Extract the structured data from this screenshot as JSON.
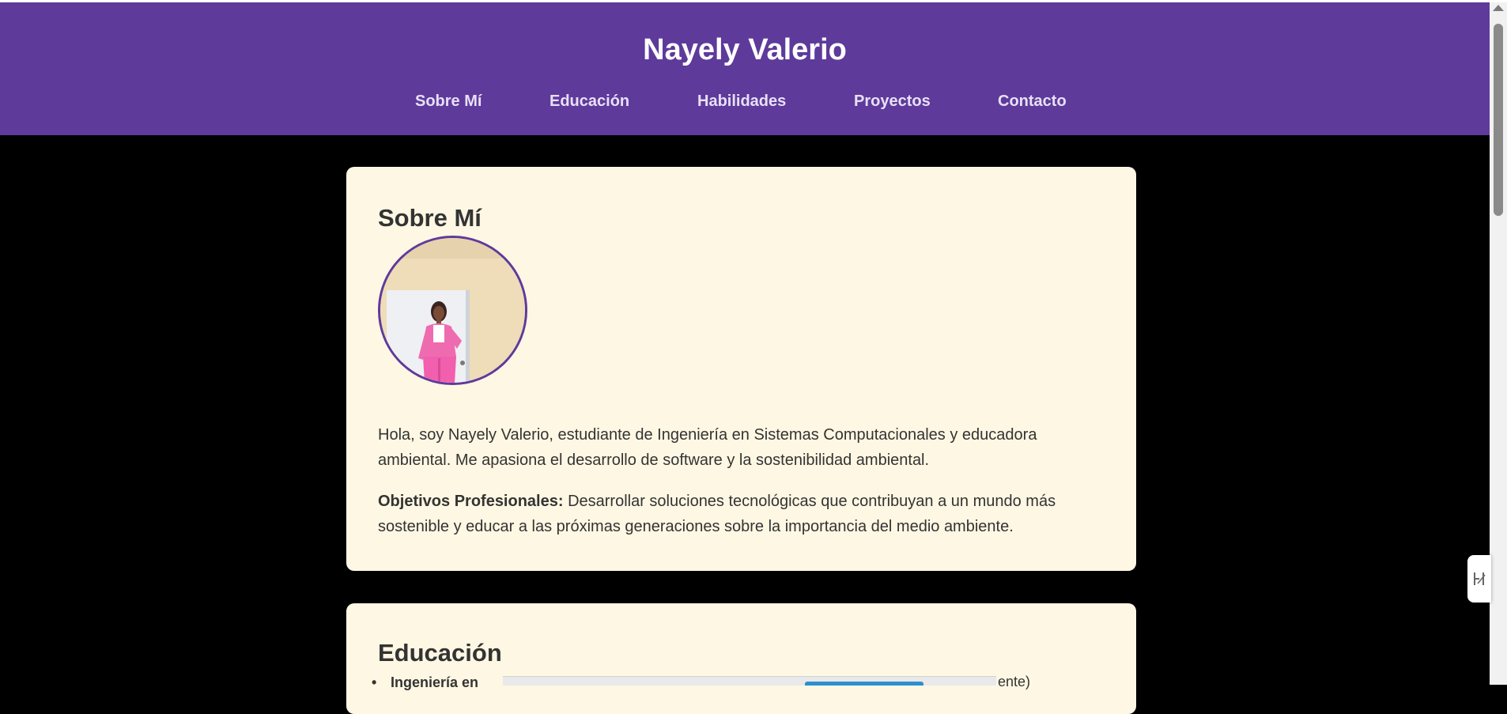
{
  "header": {
    "title": "Nayely Valerio",
    "nav": [
      {
        "label": "Sobre Mí"
      },
      {
        "label": "Educación"
      },
      {
        "label": "Habilidades"
      },
      {
        "label": "Proyectos"
      },
      {
        "label": "Contacto"
      }
    ]
  },
  "about": {
    "heading": "Sobre Mí",
    "intro": "Hola, soy Nayely Valerio, estudiante de Ingeniería en Sistemas Computacionales y educadora ambiental. Me apasiona el desarrollo de software y la sostenibilidad ambiental.",
    "goals_label": "Objetivos Profesionales:",
    "goals_text": " Desarrollar soluciones tecnológicas que contribuyan a un mundo más sostenible y educar a las próximas generaciones sobre la importancia del medio ambiente."
  },
  "education": {
    "heading": "Educación",
    "first_item_start": "Ingeniería en",
    "first_item_end": "ente)"
  },
  "icons": {
    "avatar": "profile-photo",
    "side_widget": "translate-icon"
  },
  "colors": {
    "header": "#5e3a9b",
    "card": "#fef7e3",
    "page_background": "#000000"
  }
}
